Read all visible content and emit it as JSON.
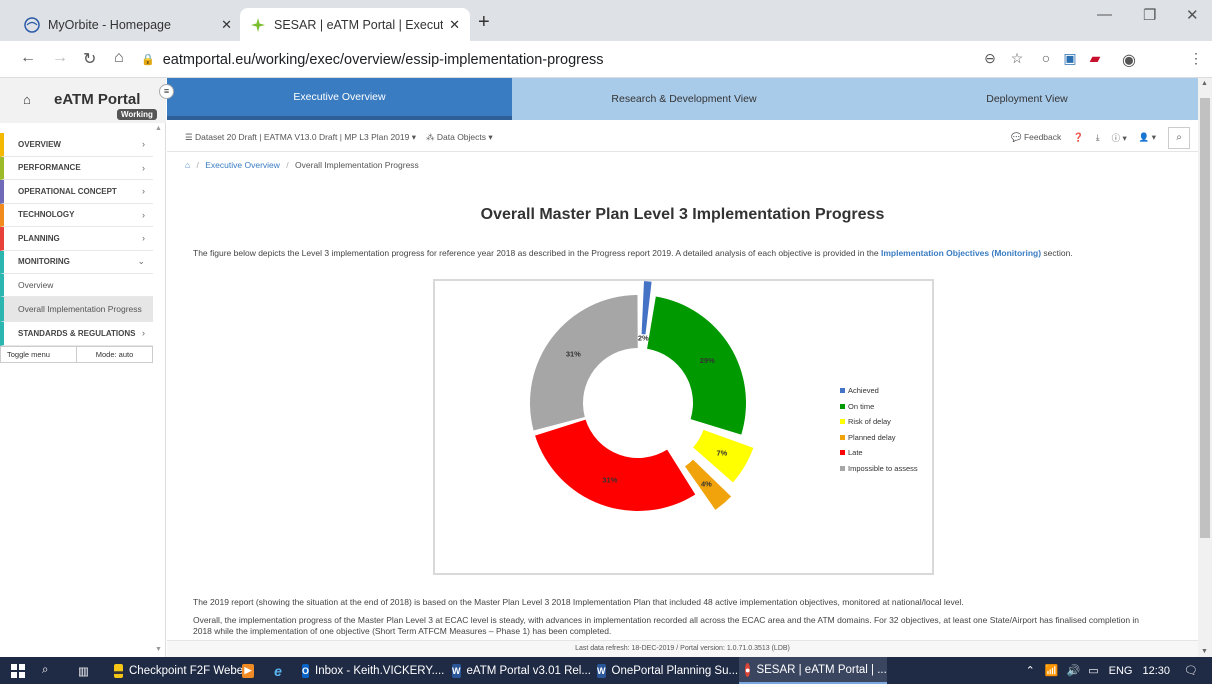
{
  "browser": {
    "tabs": [
      {
        "title": "MyOrbite - Homepage",
        "active": false
      },
      {
        "title": "SESAR | eATM Portal | Executive O",
        "active": true
      }
    ],
    "url": "eatmportal.eu/working/exec/overview/essip-implementation-progress"
  },
  "portal": {
    "name": "eATM Portal",
    "badge": "Working",
    "views": [
      "Executive Overview",
      "Research & Development View",
      "Deployment View"
    ],
    "toolbar": {
      "dataset": "Dataset 20 Draft | EATMA V13.0 Draft | MP L3 Plan 2019",
      "data_objects": "Data Objects",
      "feedback": "Feedback"
    },
    "breadcrumb": {
      "link": "Executive Overview",
      "current": "Overall Implementation Progress"
    }
  },
  "sidebar": {
    "items": [
      {
        "label": "OVERVIEW",
        "color": "#f5b800",
        "chev": "›"
      },
      {
        "label": "PERFORMANCE",
        "color": "#9bbb2a",
        "chev": "›"
      },
      {
        "label": "OPERATIONAL CONCEPT",
        "color": "#6f6bb8",
        "chev": "›"
      },
      {
        "label": "TECHNOLOGY",
        "color": "#f28b1e",
        "chev": "›"
      },
      {
        "label": "PLANNING",
        "color": "#e8413a",
        "chev": "›"
      },
      {
        "label": "MONITORING",
        "color": "#2bb6b0",
        "chev": "⌄"
      }
    ],
    "sub_items": [
      "Overview",
      "Overall Implementation Progress"
    ],
    "last_item": {
      "label": "STANDARDS & REGULATIONS",
      "chev": "›"
    },
    "toggle_menu": "Toggle menu",
    "mode": "Mode: auto"
  },
  "page": {
    "title": "Overall Master Plan Level 3 Implementation Progress",
    "intro_before": "The figure below depicts the Level 3 implementation progress for reference year 2018 as described in the Progress report 2019. A detailed analysis of each objective is provided in the ",
    "intro_link": "Implementation Objectives (Monitoring)",
    "intro_after": " section.",
    "para1": "The 2019 report (showing the situation at the end of 2018) is based on the Master Plan Level 3 2018 Implementation Plan that included 48 active implementation objectives, monitored at national/local level.",
    "para2": "Overall, the implementation progress of the Master Plan Level 3 at ECAC level is steady, with advances in implementation recorded all across the ECAC area and the ATM domains. For 32 objectives, at least one State/Airport has finalised completion in 2018 while the implementation of one objective (Short Term ATFCM Measures – Phase 1) has been completed.",
    "footer": "Last data refresh: 18-DEC-2019 / Portal version: 1.0.71.0.3513 (LDB)"
  },
  "chart_data": {
    "type": "pie",
    "variant": "exploded-doughnut",
    "categories": [
      "Achieved",
      "On time",
      "Risk of delay",
      "Planned delay",
      "Late",
      "Impossible to assess"
    ],
    "values": [
      2,
      29,
      7,
      4,
      31,
      31
    ],
    "labels": [
      "2%",
      "29%",
      "7%",
      "4%",
      "31%",
      "31%"
    ],
    "colors": [
      "#4472c4",
      "#009900",
      "#ffff00",
      "#f0a30a",
      "#ff0000",
      "#a6a6a6"
    ],
    "legend_position": "right",
    "title": ""
  },
  "taskbar": {
    "items": [
      "Checkpoint F2F Webe...",
      "",
      "",
      "Inbox - Keith.VICKERY....",
      "eATM Portal v3.01 Rel...",
      "OnePortal Planning Su...",
      "SESAR | eATM Portal | ..."
    ],
    "lang": "ENG",
    "time": "12:30"
  }
}
